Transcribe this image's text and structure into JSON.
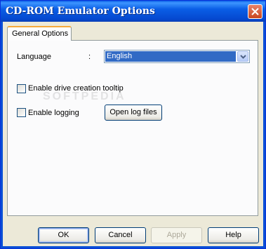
{
  "window": {
    "title": "CD-ROM Emulator Options"
  },
  "tabs": [
    {
      "label": "General Options",
      "active": true
    }
  ],
  "language": {
    "label": "Language",
    "separator": ":",
    "selected": "English"
  },
  "options": {
    "tooltip_label": "Enable drive creation tooltip",
    "tooltip_checked": false,
    "logging_label": "Enable logging",
    "logging_checked": false,
    "open_log_label": "Open log files"
  },
  "buttons": {
    "ok": "OK",
    "cancel": "Cancel",
    "apply": "Apply",
    "help": "Help"
  },
  "watermark": "SOFTPEDIA",
  "colors": {
    "title_bar": "#0a5ee6",
    "selection": "#316ac5",
    "tab_highlight": "#f5a93a"
  }
}
